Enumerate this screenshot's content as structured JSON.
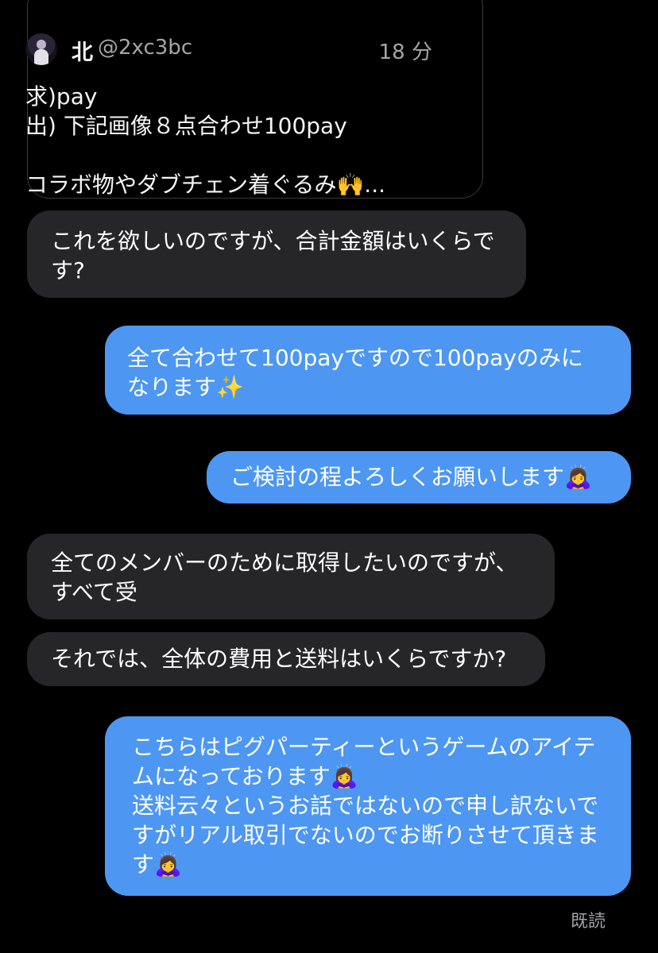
{
  "quoted_post": {
    "author_name": "北",
    "author_handle": "@2xc3bc",
    "time": "18 分",
    "lines": [
      "求)pay",
      "出) 下記画像８点合わせ100pay",
      "",
      "コラボ物やダブチェン着ぐるみ🙌..."
    ],
    "avatar_icon": "user-avatar-icon"
  },
  "messages": [
    {
      "sender": "other",
      "lines": [
        "これを欲しいのですが、合計金額はいくらで",
        "す?"
      ]
    },
    {
      "sender": "me",
      "lines": [
        "全て合わせて100payですので100payのみに",
        "なります✨"
      ]
    },
    {
      "sender": "me",
      "lines": [
        "ご検討の程よろしくお願いします🙇‍♀️"
      ]
    },
    {
      "sender": "other",
      "lines": [
        "全てのメンバーのために取得したいのですが、",
        "すべて受"
      ]
    },
    {
      "sender": "other",
      "lines": [
        "それでは、全体の費用と送料はいくらですか?"
      ]
    },
    {
      "sender": "me",
      "lines": [
        "こちらはピグパーティーというゲームのアイテ",
        "ムになっております🙇‍♀️",
        "送料云々というお話ではないので申し訳ないで",
        "すがリアル取引でないのでお断りさせて頂きま",
        "す🙇‍♀️"
      ]
    }
  ],
  "read_status": "既読",
  "colors": {
    "background": "#000000",
    "incoming_bubble": "#262628",
    "outgoing_bubble": "#4d97f2",
    "secondary_text": "#a5a5a8"
  }
}
